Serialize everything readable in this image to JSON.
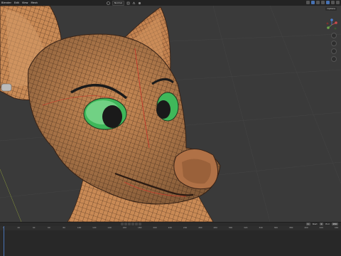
{
  "menu": [
    "Blender",
    "Edit",
    "View",
    "Mesh"
  ],
  "header": {
    "mode": "Normal"
  },
  "overlay": {
    "options_label": "Options"
  },
  "frames": {
    "current": "1",
    "start_label": "Start",
    "start": "1",
    "end_label": "End",
    "end": "250"
  },
  "ruler_ticks": [
    "0",
    "20",
    "40",
    "60",
    "80",
    "100",
    "120",
    "140",
    "160",
    "180",
    "200",
    "220",
    "240",
    "260",
    "280",
    "300",
    "320",
    "340",
    "360",
    "380",
    "400",
    "420",
    "440"
  ],
  "colors": {
    "skin": "#c98a55",
    "wire": "#3b2417",
    "seam": "#c63a2b",
    "eye": "#3fb85a",
    "pupil": "#1a1a1a",
    "bg": "#3a3a3a",
    "accent": "#4772b3"
  }
}
